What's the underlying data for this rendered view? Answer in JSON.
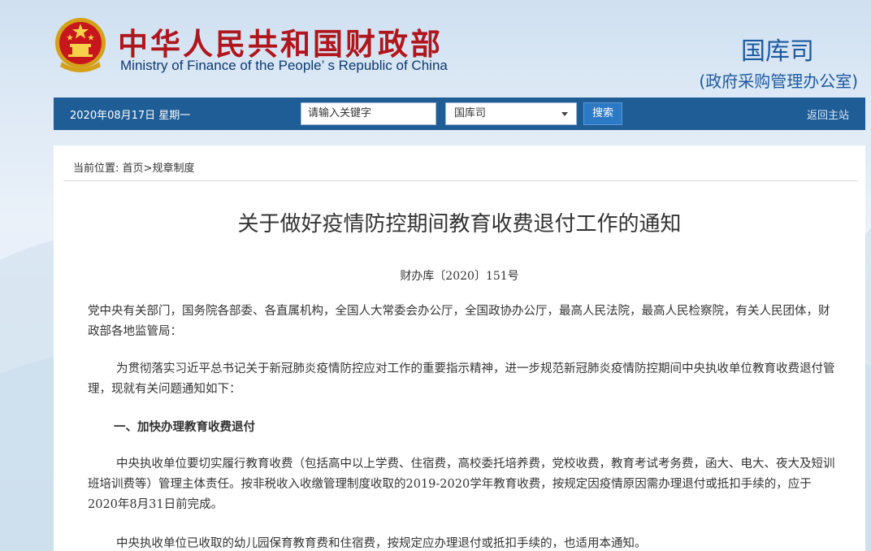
{
  "header": {
    "site_title_cn": "中华人民共和国财政部",
    "site_title_en": "Ministry of Finance of the People’ s Republic of China",
    "dept_name": "国库司",
    "dept_sub": "(政府采购管理办公室)"
  },
  "navbar": {
    "date": "2020年08月17日  星期一",
    "search_placeholder": "请输入关键字",
    "scope_selected": "国库司",
    "search_button": "搜索",
    "home_link": "返回主站"
  },
  "breadcrumb": {
    "prefix": "当前位置:",
    "home": "首页",
    "separator": ">",
    "current": "规章制度"
  },
  "article": {
    "title": "关于做好疫情防控期间教育收费退付工作的通知",
    "doc_number": "财办库〔2020〕151号",
    "addressees": "党中央有关部门，国务院各部委、各直属机构，全国人大常委会办公厅，全国政协办公厅，最高人民法院，最高人民检察院，有关人民团体，财政部各地监管局：",
    "intro": "为贯彻落实习近平总书记关于新冠肺炎疫情防控应对工作的重要指示精神，进一步规范新冠肺炎疫情防控期间中央执收单位教育收费退付管理，现就有关问题通知如下：",
    "section1_heading": "一、加快办理教育收费退付",
    "section1_p1": "中央执收单位要切实履行教育收费（包括高中以上学费、住宿费，高校委托培养费，党校收费，教育考试考务费，函大、电大、夜大及短训班培训费等）管理主体责任。按非税收入收缴管理制度收取的2019-2020学年教育收费，按规定因疫情原因需办理退付或抵扣手续的，应于2020年8月31日前完成。",
    "section1_p2": "中央执收单位已收取的幼儿园保育教育费和住宿费，按规定应办理退付或抵扣手续的，也适用本通知。"
  },
  "colors": {
    "title_red": "#b0161c",
    "nav_blue": "#1f5d96",
    "button_blue": "#2c79c5",
    "dept_blue": "#1d5aa0"
  },
  "icons": {
    "emblem": "national-emblem-icon",
    "dropdown": "chevron-down-icon"
  }
}
